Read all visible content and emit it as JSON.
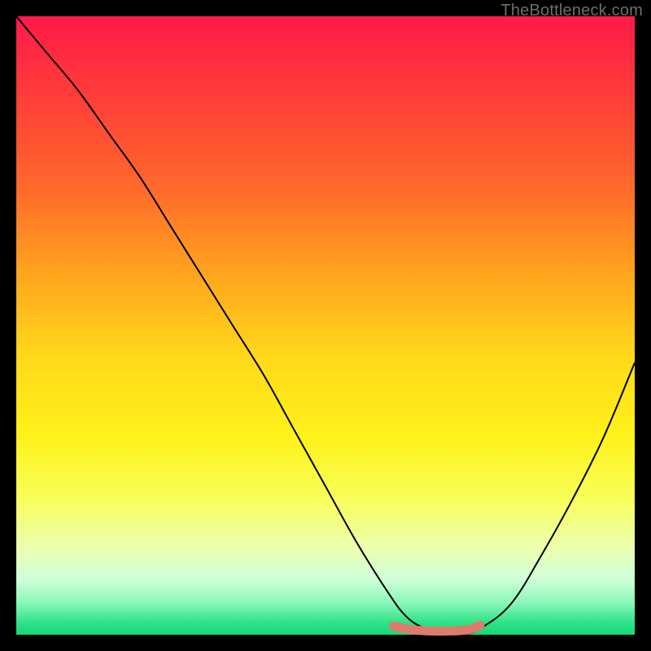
{
  "watermark": "TheBottleneck.com",
  "chart_data": {
    "type": "line",
    "title": "",
    "xlabel": "",
    "ylabel": "",
    "xlim": [
      0,
      100
    ],
    "ylim": [
      0,
      100
    ],
    "series": [
      {
        "name": "bottleneck-curve",
        "color": "#000000",
        "width": 2,
        "x": [
          0,
          5,
          10,
          15,
          20,
          25,
          30,
          35,
          40,
          45,
          50,
          55,
          60,
          63,
          66,
          69,
          72,
          75,
          80,
          85,
          90,
          95,
          100
        ],
        "values": [
          100,
          94,
          88,
          81,
          74,
          66,
          58,
          50,
          42,
          33,
          24,
          15,
          7,
          3,
          1,
          0,
          0,
          1,
          5,
          13,
          22,
          32,
          44
        ]
      },
      {
        "name": "optimal-band",
        "color": "#e07a6a",
        "width": 11,
        "linecap": "round",
        "x": [
          61,
          64,
          67,
          70,
          73,
          75
        ],
        "values": [
          1.4,
          0.8,
          0.6,
          0.6,
          0.8,
          1.5
        ]
      }
    ]
  }
}
